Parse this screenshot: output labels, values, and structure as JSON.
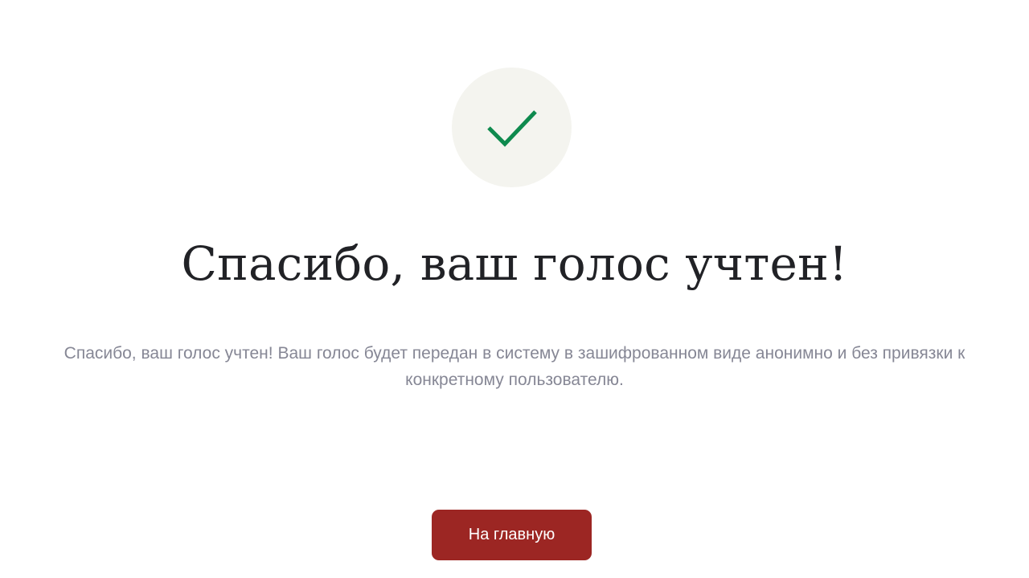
{
  "status": {
    "icon": "checkmark-icon",
    "icon_color": "#0e8a4e",
    "badge_background": "#f4f4ef"
  },
  "title": "Спасибо, ваш голос учтен!",
  "description": "Спасибо, ваш голос учтен! Ваш голос будет передан в систему в зашифрованном виде анонимно и без привязки к конкретному пользователю.",
  "actions": {
    "home_label": "На главную",
    "home_color": "#9c2623"
  }
}
